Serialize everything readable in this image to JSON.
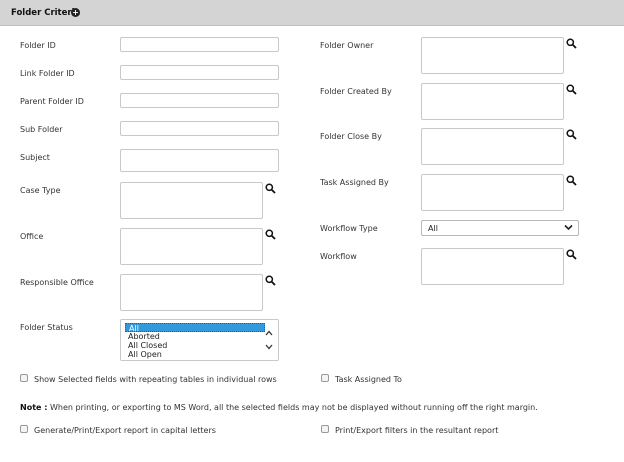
{
  "header": {
    "title": "Folder Criteria",
    "toggle_icon": "plus-circle-icon"
  },
  "left": {
    "folder_id": "Folder ID",
    "link_folder_id": "Link Folder ID",
    "parent_folder_id": "Parent Folder ID",
    "sub_folder": "Sub Folder",
    "subject": "Subject",
    "case_type": "Case Type",
    "office": "Office",
    "responsible_office": "Responsible Office",
    "folder_status": "Folder Status"
  },
  "right": {
    "folder_owner": "Folder Owner",
    "folder_created_by": "Folder Created By",
    "folder_close_by": "Folder Close By",
    "task_assigned_by": "Task Assigned By",
    "workflow_type": "Workflow Type",
    "workflow_type_value": "All",
    "workflow": "Workflow"
  },
  "folder_status_options": [
    "All",
    "Aborted",
    "All Closed",
    "All Open"
  ],
  "folder_status_selected": "All",
  "checkboxes": {
    "show_selected": "Show Selected fields with repeating tables in individual rows",
    "task_assigned_to": "Task Assigned To",
    "capital_letters": "Generate/Print/Export report in capital letters",
    "print_filters": "Print/Export filters in the resultant report"
  },
  "note": {
    "label": "Note :",
    "text": "When printing, or exporting to MS Word, all the selected fields may not be displayed without running off the right margin."
  },
  "icons": {
    "search": "search-icon",
    "chevron": "chevron-down-icon"
  },
  "colors": {
    "header_bg": "#d4d4d4",
    "selected_option": "#3399dd"
  }
}
